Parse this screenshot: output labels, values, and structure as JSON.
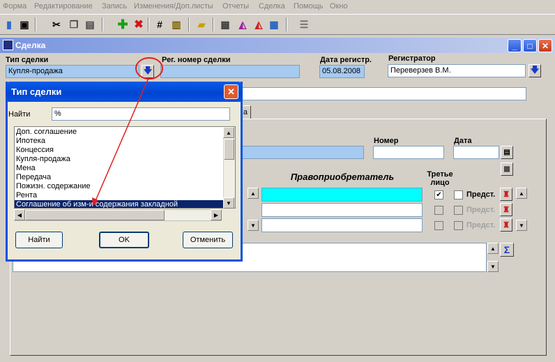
{
  "menu": [
    "Форма",
    "Редактирование",
    "Запись",
    "Изменения/Доп.листы",
    "Отчеты",
    "Сделка",
    "Помощь",
    "Окно"
  ],
  "window": {
    "title": "Сделка"
  },
  "deal": {
    "type_label": "Тип сделки",
    "type_value": "Купля-продажа",
    "regnum_label": "Рег. номер сделки",
    "regnum_value": "",
    "regdate_label": "Дата регистр.",
    "regdate_value": "05.08.2008",
    "registrar_label": "Регистратор",
    "registrar_value": "Переверзев В.М."
  },
  "doc": {
    "number_label": "Номер",
    "date_label": "Дата"
  },
  "parties": {
    "acquirer_label": "Правоприобретатель",
    "third_label": "Третье лицо",
    "rows": [
      {
        "third_checked": "✔",
        "repr_label": "Предст."
      },
      {
        "third_checked": "",
        "repr_label": "Предст."
      },
      {
        "third_checked": "",
        "repr_label": "Предст."
      }
    ]
  },
  "sum_button": "Σ",
  "tab_fragment": "а",
  "dialog": {
    "title": "Тип сделки",
    "find_label": "Найти",
    "find_value": "%",
    "items": [
      "Доп. соглашение",
      "Ипотека",
      "Концессия",
      "Купля-продажа",
      "Мена",
      "Передача",
      "Пожизн. содержание",
      "Рента",
      "Соглашение об изм-и содержания закладной"
    ],
    "selected_index": 8,
    "buttons": {
      "find": "Найти",
      "ok": "OK",
      "cancel": "Отменить"
    }
  },
  "colors": {
    "title_bar": "#0a52e0",
    "highlight": "#a6caf0",
    "cyan_field": "#00ffff",
    "annotation": "#e02020"
  }
}
